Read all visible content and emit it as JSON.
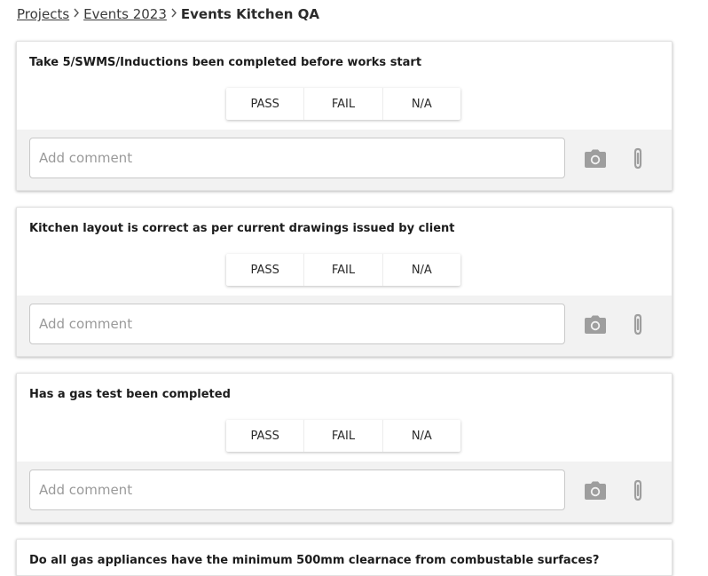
{
  "breadcrumb": {
    "items": [
      "Projects",
      "Events 2023"
    ],
    "current": "Events Kitchen QA"
  },
  "options": [
    "PASS",
    "FAIL",
    "N/A"
  ],
  "comment_placeholder": "Add comment",
  "icon_color": "#9e9e9e",
  "questions": [
    "Take 5/SWMS/Inductions been completed before works start",
    "Kitchen layout is correct as per current drawings issued by client",
    "Has a gas test been completed",
    "Do all gas appliances have the minimum 500mm clearnace from combustable surfaces?"
  ]
}
